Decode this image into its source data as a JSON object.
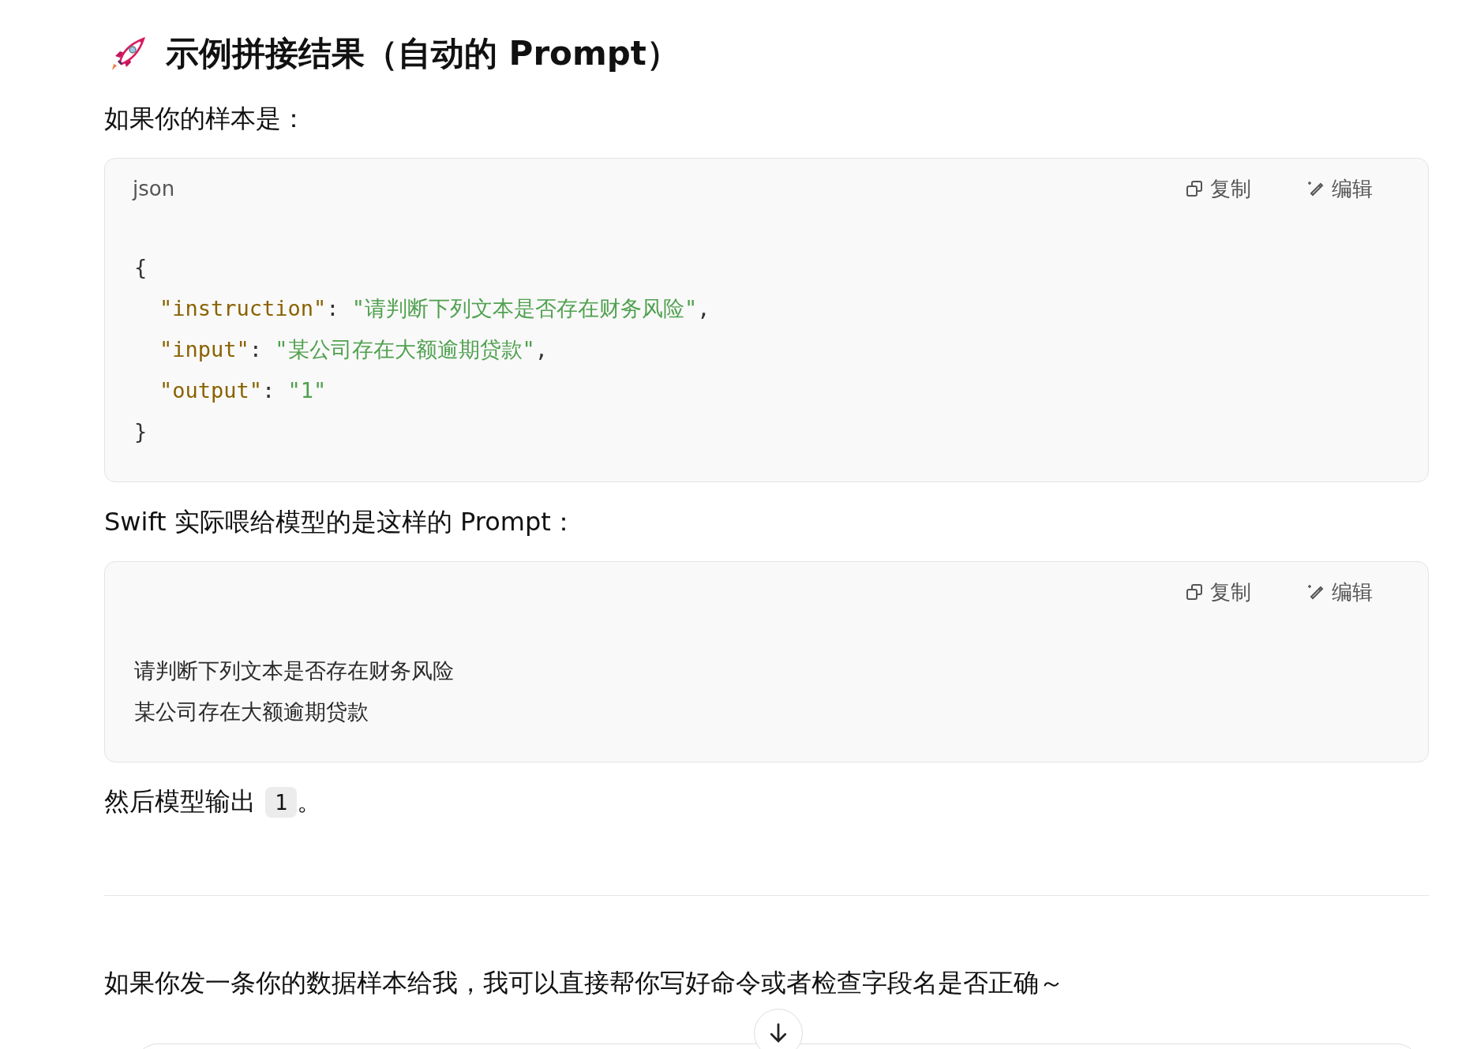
{
  "heading": "示例拼接结果（自动的 Prompt）",
  "intro": "如果你的样本是：",
  "code_blocks": [
    {
      "language": "json",
      "actions": [
        {
          "kind": "copy",
          "label": "复制"
        },
        {
          "kind": "edit",
          "label": "编辑"
        }
      ],
      "lines": [
        {
          "indented": false,
          "tokens": [
            {
              "kind": "punct",
              "text": "{"
            }
          ]
        },
        {
          "indented": true,
          "tokens": [
            {
              "kind": "key",
              "text": "\"instruction\""
            },
            {
              "kind": "punct",
              "text": ": "
            },
            {
              "kind": "string",
              "text": "\"请判断下列文本是否存在财务风险\""
            },
            {
              "kind": "punct",
              "text": ","
            }
          ]
        },
        {
          "indented": true,
          "tokens": [
            {
              "kind": "key",
              "text": "\"input\""
            },
            {
              "kind": "punct",
              "text": ": "
            },
            {
              "kind": "string",
              "text": "\"某公司存在大额逾期贷款\""
            },
            {
              "kind": "punct",
              "text": ","
            }
          ]
        },
        {
          "indented": true,
          "tokens": [
            {
              "kind": "key",
              "text": "\"output\""
            },
            {
              "kind": "punct",
              "text": ": "
            },
            {
              "kind": "string",
              "text": "\"1\""
            }
          ]
        },
        {
          "indented": false,
          "tokens": [
            {
              "kind": "punct",
              "text": "}"
            }
          ]
        }
      ]
    },
    {
      "actions": [
        {
          "kind": "copy",
          "label": "复制"
        },
        {
          "kind": "edit",
          "label": "编辑"
        }
      ],
      "lines": [
        {
          "indented": false,
          "tokens": [
            {
              "kind": "plain",
              "text": "请判断下列文本是否存在财务风险"
            }
          ]
        },
        {
          "indented": false,
          "tokens": [
            {
              "kind": "plain",
              "text": "某公司存在大额逾期贷款"
            }
          ]
        }
      ]
    }
  ],
  "mid_text": "Swift 实际喂给模型的是这样的 Prompt：",
  "output_text": {
    "before": "然后模型输出",
    "code": "1",
    "after": "。"
  },
  "closing_text": "如果你发一条你的数据样本给我，我可以直接帮你写好命令或者检查字段名是否正确～"
}
